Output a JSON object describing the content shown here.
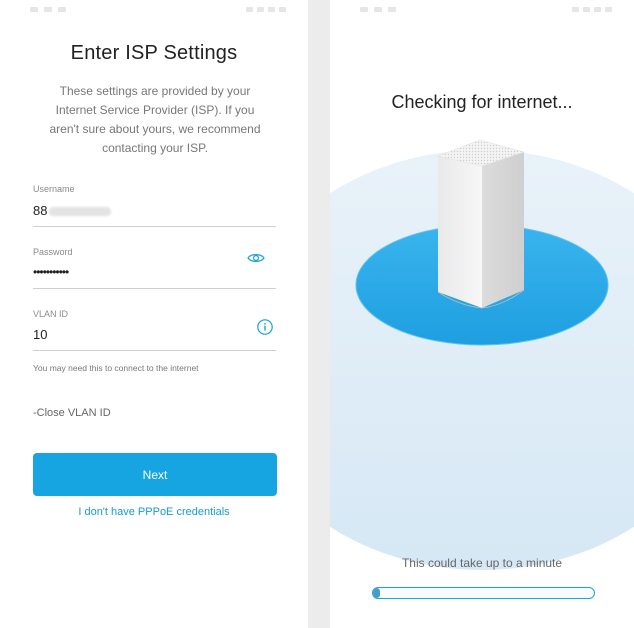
{
  "isp_screen": {
    "title": "Enter ISP Settings",
    "description": "These settings are provided by your Internet Service Provider (ISP). If you aren't sure about yours, we recommend contacting your ISP.",
    "username": {
      "label": "Username",
      "value_visible": "88"
    },
    "password": {
      "label": "Password",
      "value": "•••••••••••"
    },
    "vlan": {
      "label": "VLAN ID",
      "value": "10",
      "hint": "You may need this to connect to the internet"
    },
    "close_vlan_label": "-Close VLAN ID",
    "next_label": "Next",
    "no_credentials_link": "I don't have PPPoE credentials",
    "colors": {
      "accent": "#16a5e0"
    }
  },
  "checking_screen": {
    "title": "Checking for internet...",
    "subtitle": "This could take up to a minute",
    "progress": 0.03,
    "colors": {
      "disc": "#29a9e6",
      "halo": "#dcebf6"
    }
  }
}
